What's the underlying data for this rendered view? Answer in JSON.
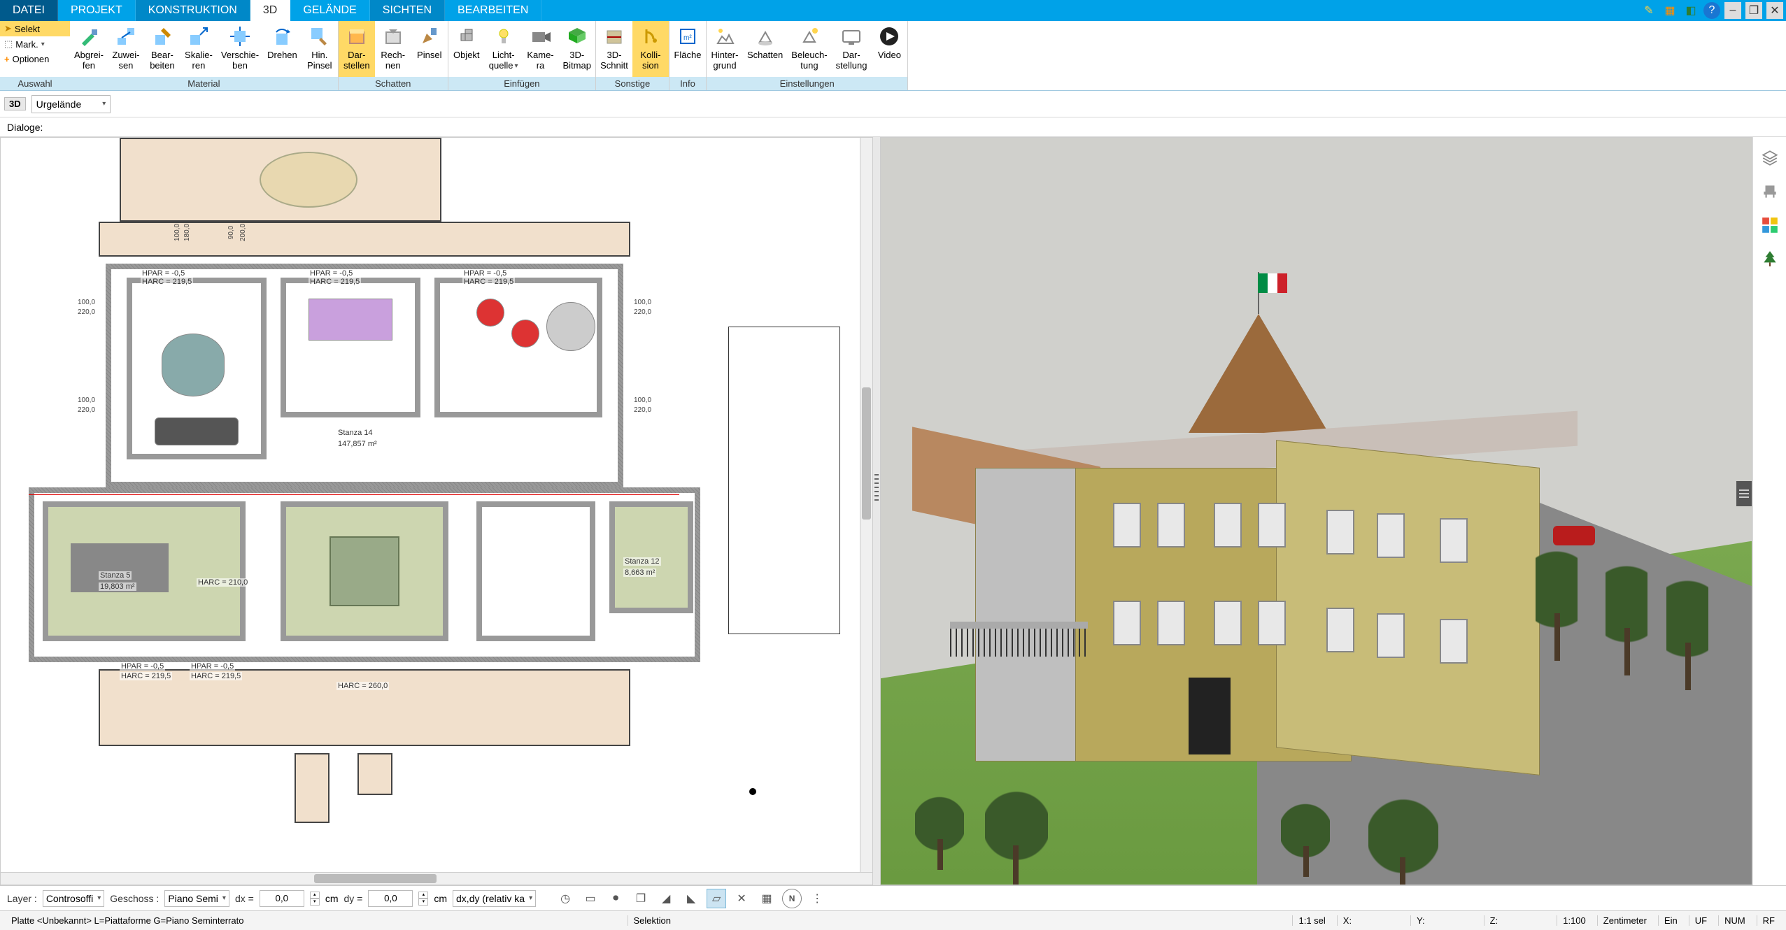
{
  "menu": {
    "items": [
      "DATEI",
      "PROJEKT",
      "KONSTRUKTION",
      "3D",
      "GELÄNDE",
      "SICHTEN",
      "BEARBEITEN"
    ],
    "active_index": 3
  },
  "ribbon_left": {
    "selekt": "Selekt",
    "mark": "Mark.",
    "optionen": "Optionen",
    "group_label": "Auswahl"
  },
  "ribbon_groups": [
    {
      "label": "Material",
      "buttons": [
        {
          "name": "abgreifen",
          "line1": "Abgrei-",
          "line2": "fen"
        },
        {
          "name": "zuweisen",
          "line1": "Zuwei-",
          "line2": "sen"
        },
        {
          "name": "bearbeiten",
          "line1": "Bear-",
          "line2": "beiten"
        },
        {
          "name": "skalieren",
          "line1": "Skalie-",
          "line2": "ren"
        },
        {
          "name": "verschieben",
          "line1": "Verschie-",
          "line2": "ben"
        },
        {
          "name": "drehen",
          "line1": "Drehen",
          "line2": ""
        },
        {
          "name": "hin-pinsel",
          "line1": "Hin.",
          "line2": "Pinsel"
        }
      ]
    },
    {
      "label": "Schatten",
      "buttons": [
        {
          "name": "darstellen",
          "line1": "Dar-",
          "line2": "stellen",
          "active": true
        },
        {
          "name": "rechnen",
          "line1": "Rech-",
          "line2": "nen"
        },
        {
          "name": "pinsel",
          "line1": "Pinsel",
          "line2": ""
        }
      ]
    },
    {
      "label": "Einfügen",
      "buttons": [
        {
          "name": "objekt",
          "line1": "Objekt",
          "line2": ""
        },
        {
          "name": "lichtquelle",
          "line1": "Licht-",
          "line2": "quelle",
          "dropdown": true
        },
        {
          "name": "kamera",
          "line1": "Kame-",
          "line2": "ra"
        },
        {
          "name": "3d-bitmap",
          "line1": "3D-",
          "line2": "Bitmap"
        }
      ]
    },
    {
      "label": "Sonstige",
      "buttons": [
        {
          "name": "3d-schnitt",
          "line1": "3D-",
          "line2": "Schnitt"
        },
        {
          "name": "kollision",
          "line1": "Kolli-",
          "line2": "sion",
          "active": true
        }
      ]
    },
    {
      "label": "Info",
      "buttons": [
        {
          "name": "flaeche",
          "line1": "Fläche",
          "line2": ""
        }
      ]
    },
    {
      "label": "Einstellungen",
      "buttons": [
        {
          "name": "hintergrund",
          "line1": "Hinter-",
          "line2": "grund"
        },
        {
          "name": "schatten",
          "line1": "Schatten",
          "line2": ""
        },
        {
          "name": "beleuchtung",
          "line1": "Beleuch-",
          "line2": "tung"
        },
        {
          "name": "darstellung",
          "line1": "Dar-",
          "line2": "stellung"
        },
        {
          "name": "video",
          "line1": "Video",
          "line2": ""
        }
      ]
    }
  ],
  "secondary": {
    "view_mode_badge": "3D",
    "terrain_select": "Urgelände"
  },
  "dialog_bar": {
    "label": "Dialoge:"
  },
  "floorplan_labels": {
    "room14": "Stanza 14",
    "room14_area": "147,857 m²",
    "room5": "Stanza 5",
    "room5_area": "19,803 m²",
    "room12": "Stanza 12",
    "room12_area": "8,663 m²",
    "harc": "HARC = 219,5",
    "hpar": "HPAR = -0,5",
    "harc210": "HARC = 210,0",
    "harc260": "HARC = 260,0",
    "dim100": "100,0",
    "dim220": "220,0",
    "dim90": "90,0",
    "dim200": "200,0",
    "dim180": "180,0"
  },
  "bottom": {
    "layer_label": "Layer :",
    "layer_value": "Controsoffi",
    "geschoss_label": "Geschoss :",
    "geschoss_value": "Piano Semi",
    "dx_label": "dx =",
    "dx_value": "0,0",
    "dy_label": "dy =",
    "dy_value": "0,0",
    "unit": "cm",
    "mode_select": "dx,dy (relativ ka"
  },
  "status": {
    "left": "Platte  <Unbekannt>  L=Piattaforme G=Piano Seminterrato",
    "selektion": "Selektion",
    "sel_count": "1:1 sel",
    "x": "X:",
    "y": "Y:",
    "z": "Z:",
    "scale": "1:100",
    "unit": "Zentimeter",
    "ein": "Ein",
    "uf": "UF",
    "num": "NUM",
    "rf": "RF"
  }
}
